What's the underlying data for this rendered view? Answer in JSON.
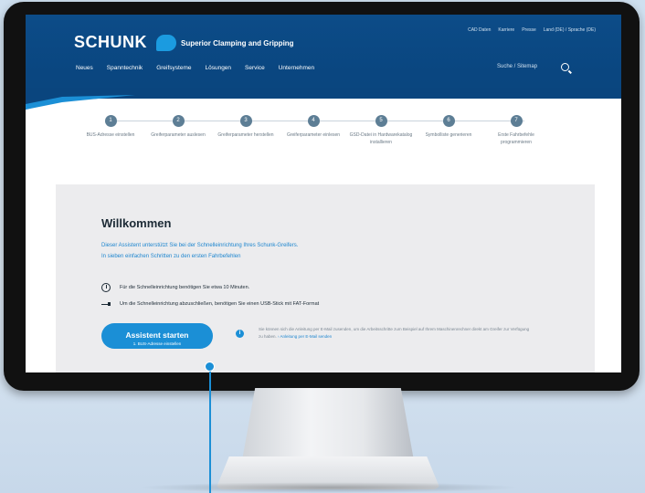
{
  "header": {
    "logo": "SCHUNK",
    "tagline": "Superior Clamping and Gripping",
    "toplinks": [
      "CAD Daten",
      "Karriere",
      "Presse",
      "Land (DE) / Sprache (DE)"
    ],
    "nav": [
      "Neues",
      "Spanntechnik",
      "Greifsysteme",
      "Lösungen",
      "Service",
      "Unternehmen"
    ],
    "search_placeholder": "Suche / Sitemap"
  },
  "steps": [
    {
      "num": "1",
      "label": "BUS-Adresse einstellen"
    },
    {
      "num": "2",
      "label": "Greiferparameter auslesen"
    },
    {
      "num": "3",
      "label": "Greiferparameter herstellen"
    },
    {
      "num": "4",
      "label": "Greiferparameter einlesen"
    },
    {
      "num": "5",
      "label": "GSD-Datei in Hardwarekatalog installieren"
    },
    {
      "num": "6",
      "label": "Symbolliste generieren"
    },
    {
      "num": "7",
      "label": "Erste Fahrbefehle programmieren"
    }
  ],
  "welcome": {
    "title": "Willkommen",
    "intro1": "Dieser Assistent unterstützt Sie bei der Schnelleinrichtung Ihres Schunk-Greifers.",
    "intro2": "In sieben einfachen Schritten zu den ersten Fahrbefehlen",
    "info1": "Für die Schnelleinrichtung benötigen Sie etwa 10 Minuten.",
    "info2": "Um die Schnelleinrichtung abzuschließen, benötigen Sie einen USB-Stick mit FAT-Format",
    "button_main": "Assistent starten",
    "button_sub": "1. BUS-Adresse einstellen",
    "hint_icon": "i",
    "hint": "Sie können sich die Anleitung per E-Mail zusenden, um die Arbeitsschritte zum Beispiel auf Ihrem Maschinenrechner direkt am Greifer zur Verfügung zu haben.",
    "hint_link": "› Anleitung per E-Mail senden"
  },
  "colors": {
    "header": "#0a4680",
    "accent": "#1b8fd6",
    "step": "#5d7e95"
  }
}
